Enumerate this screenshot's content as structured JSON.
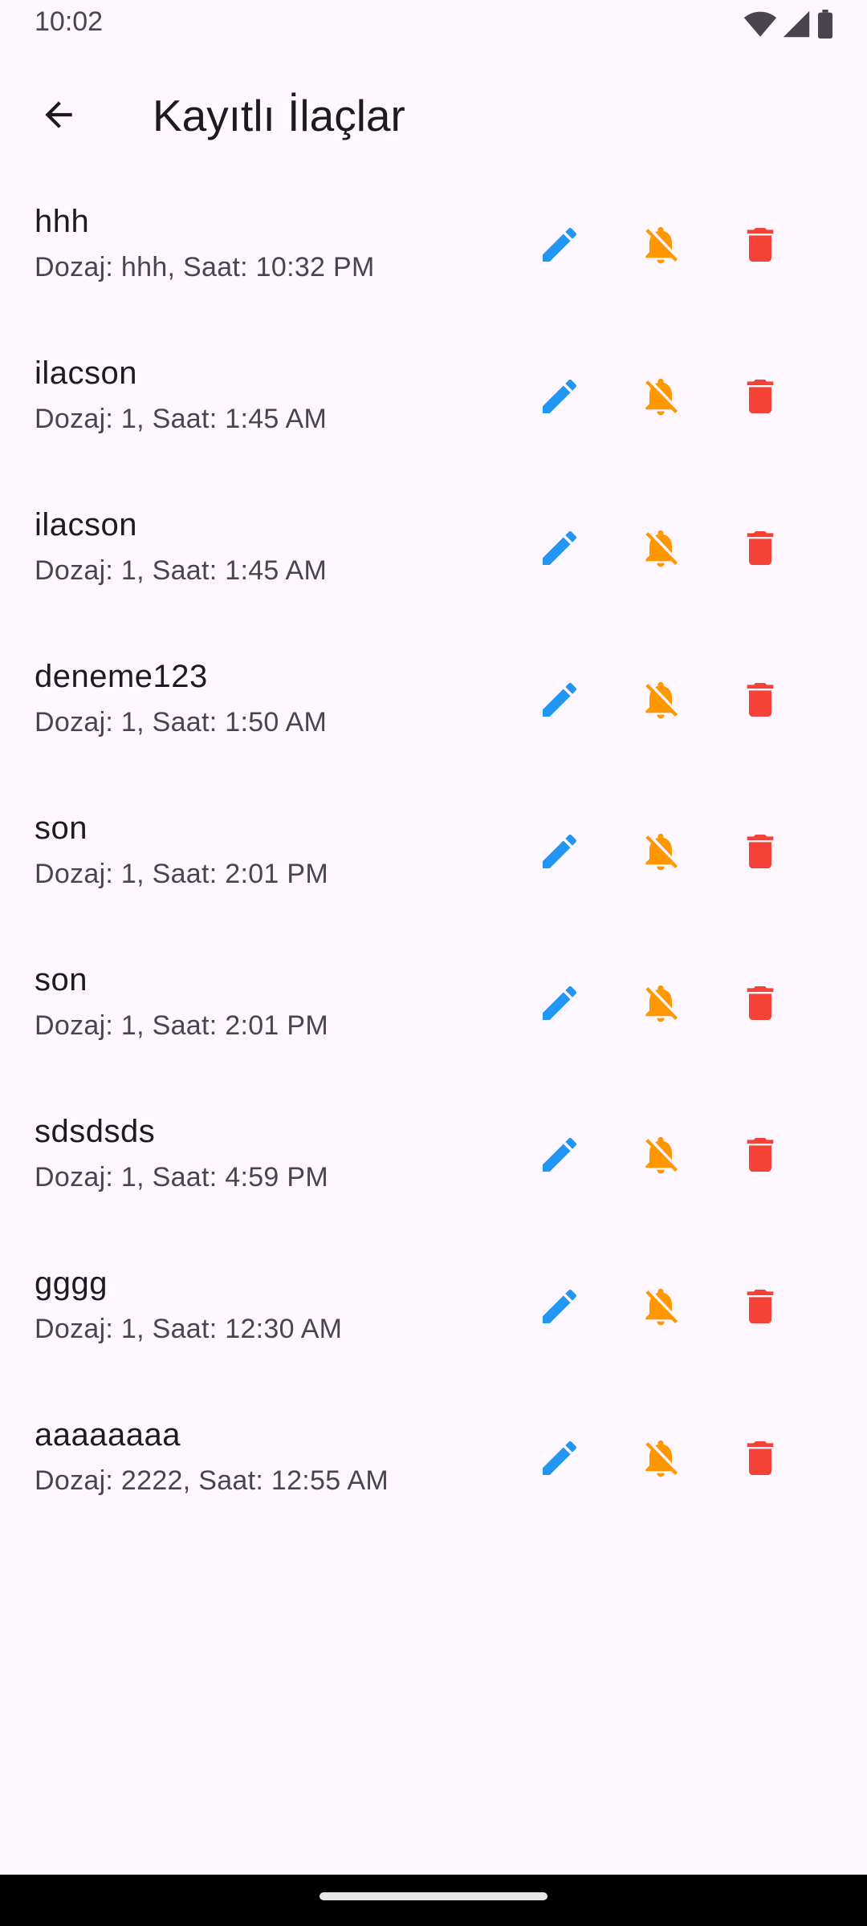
{
  "status_bar": {
    "time": "10:02"
  },
  "app_bar": {
    "title": "Kayıtlı İlaçlar"
  },
  "colors": {
    "edit": "#2196f3",
    "mute": "#ff9800",
    "delete": "#f44336"
  },
  "icons": {
    "back": "arrow-back-icon",
    "edit": "edit-icon",
    "mute": "notifications-off-icon",
    "delete": "delete-icon"
  },
  "medicines": [
    {
      "name": "hhh",
      "details": "Dozaj: hhh, Saat: 10:32 PM"
    },
    {
      "name": "ilacson",
      "details": "Dozaj: 1, Saat: 1:45 AM"
    },
    {
      "name": "ilacson",
      "details": "Dozaj: 1, Saat: 1:45 AM"
    },
    {
      "name": "deneme123",
      "details": "Dozaj: 1, Saat: 1:50 AM"
    },
    {
      "name": "son",
      "details": "Dozaj: 1, Saat: 2:01 PM"
    },
    {
      "name": "son",
      "details": "Dozaj: 1, Saat: 2:01 PM"
    },
    {
      "name": "sdsdsds",
      "details": "Dozaj: 1, Saat: 4:59 PM"
    },
    {
      "name": "gggg",
      "details": "Dozaj: 1, Saat: 12:30 AM"
    },
    {
      "name": "aaaaaaaa",
      "details": "Dozaj: 2222, Saat: 12:55 AM"
    }
  ]
}
